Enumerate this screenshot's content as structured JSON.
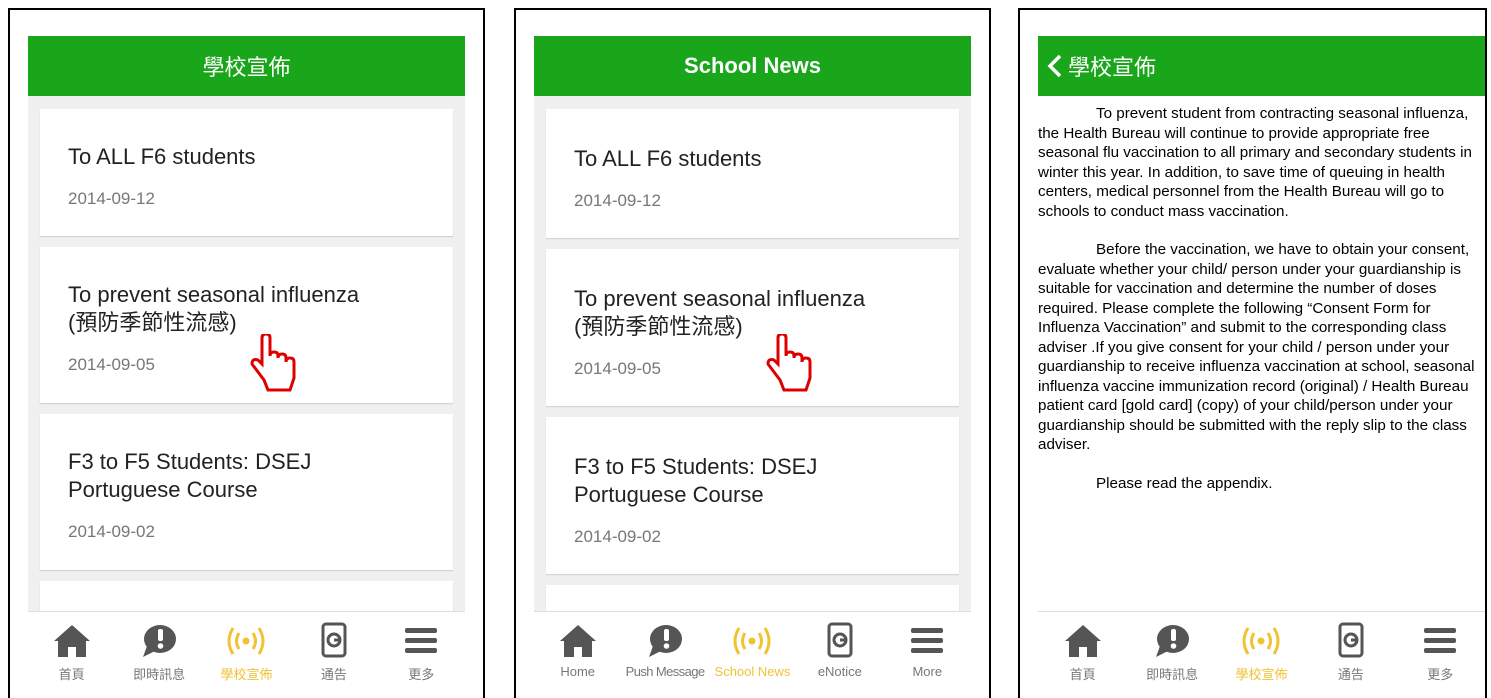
{
  "panels": [
    {
      "header_title": "學校宣佈",
      "news": [
        {
          "title": "To ALL F6 students",
          "date": "2014-09-12"
        },
        {
          "title": "To prevent seasonal influenza\n(預防季節性流感)",
          "date": "2014-09-05"
        },
        {
          "title": "F3 to F5 Students: DSEJ\nPortuguese Course",
          "date": "2014-09-02"
        }
      ],
      "tabs": [
        {
          "label": "首頁",
          "icon": "home-icon"
        },
        {
          "label": "即時訊息",
          "icon": "chat-bubble-icon"
        },
        {
          "label": "學校宣佈",
          "icon": "broadcast-icon",
          "active": true
        },
        {
          "label": "通告",
          "icon": "notice-icon"
        },
        {
          "label": "更多",
          "icon": "menu-icon"
        }
      ]
    },
    {
      "header_title": "School News",
      "news": [
        {
          "title": "To ALL F6 students",
          "date": "2014-09-12"
        },
        {
          "title": "To prevent seasonal influenza\n(預防季節性流感)",
          "date": "2014-09-05"
        },
        {
          "title": "F3 to F5 Students: DSEJ\nPortuguese Course",
          "date": "2014-09-02"
        }
      ],
      "tabs": [
        {
          "label": "Home",
          "icon": "home-icon"
        },
        {
          "label": "Push Message",
          "icon": "chat-bubble-icon"
        },
        {
          "label": "School News",
          "icon": "broadcast-icon",
          "active": true
        },
        {
          "label": "eNotice",
          "icon": "notice-icon"
        },
        {
          "label": "More",
          "icon": "menu-icon"
        }
      ]
    },
    {
      "back_label": "學校宣佈",
      "article": [
        "To prevent student from contracting seasonal influenza, the Health Bureau will continue to provide appropriate free seasonal flu vaccination to all primary and secondary students in winter this year. In addition, to save time of queuing in health centers, medical personnel from the Health Bureau will go to schools to conduct mass vaccination.",
        "Before the vaccination, we have to obtain your consent, evaluate whether your child/ person under your guardianship is suitable for vaccination and determine the number of doses required. Please complete the following “Consent Form for Influenza Vaccination” and submit to the corresponding class adviser .If you give consent for your child / person under your guardianship to receive influenza vaccination at school, seasonal influenza vaccine immunization record (original) / Health Bureau patient card [gold card] (copy) of your child/person under your guardianship should be submitted with the reply slip to the class adviser.",
        "Please read the appendix."
      ],
      "tabs": [
        {
          "label": "首頁",
          "icon": "home-icon"
        },
        {
          "label": "即時訊息",
          "icon": "chat-bubble-icon"
        },
        {
          "label": "學校宣佈",
          "icon": "broadcast-icon",
          "active": true
        },
        {
          "label": "通告",
          "icon": "notice-icon"
        },
        {
          "label": "更多",
          "icon": "menu-icon"
        }
      ]
    }
  ],
  "colors": {
    "header_green": "#1aa61a",
    "active_tab": "#f1c232",
    "inactive_icon": "#555555"
  }
}
